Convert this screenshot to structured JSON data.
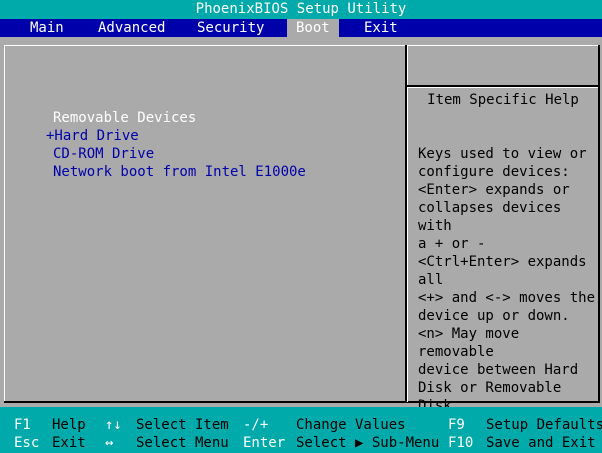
{
  "window": {
    "title": "PhoenixBIOS Setup Utility"
  },
  "menu": {
    "items": [
      "Main",
      "Advanced",
      "Security",
      "Boot",
      "Exit"
    ],
    "active": "Boot"
  },
  "boot": {
    "header": "Removable Devices",
    "devices": [
      "+Hard Drive",
      "CD-ROM Drive",
      "Network boot from Intel E1000e"
    ]
  },
  "help": {
    "title": "Item Specific Help",
    "text": "Keys used to view or\nconfigure devices:\n<Enter> expands or\ncollapses devices with\na + or -\n<Ctrl+Enter> expands\nall\n<+> and <-> moves the\ndevice up or down.\n<n> May move removable\ndevice between Hard\nDisk or Removable Disk\n<d> Remove a device\nthat is not installed."
  },
  "hints": {
    "row1": [
      {
        "key": "F1",
        "desc": "Help"
      },
      {
        "key": "↑↓",
        "desc": "Select Item"
      },
      {
        "key": "-/+",
        "desc": "Change Values"
      },
      {
        "key": "F9",
        "desc": "Setup Defaults"
      }
    ],
    "row2": [
      {
        "key": "Esc",
        "desc": "Exit"
      },
      {
        "key": "↔",
        "desc": "Select Menu"
      },
      {
        "key": "Enter",
        "desc": "Select ▶ Sub-Menu"
      },
      {
        "key": "F10",
        "desc": "Save and Exit"
      }
    ]
  },
  "colors": {
    "title_bg": "#00aaaa",
    "menu_bg": "#0000aa",
    "panel_bg": "#aaaaaa",
    "highlight_text": "#ffffff",
    "device_text": "#0000aa"
  }
}
